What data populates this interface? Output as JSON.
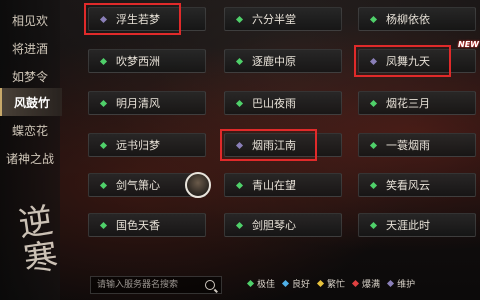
{
  "sidebar": {
    "items": [
      {
        "label": "相见欢"
      },
      {
        "label": "将进酒"
      },
      {
        "label": "如梦令"
      },
      {
        "label": "风鼓竹"
      },
      {
        "label": "蝶恋花"
      },
      {
        "label": "诸神之战"
      }
    ],
    "active_index": 3,
    "calligraphy": "逆寒"
  },
  "servers": [
    {
      "name": "浮生若梦",
      "status": "repair",
      "highlighted": true
    },
    {
      "name": "六分半堂",
      "status": "good",
      "highlighted": false
    },
    {
      "name": "杨柳依依",
      "status": "good",
      "highlighted": false
    },
    {
      "name": "吹梦西洲",
      "status": "good",
      "highlighted": false
    },
    {
      "name": "逐鹿中原",
      "status": "good",
      "highlighted": false
    },
    {
      "name": "凤舞九天",
      "status": "repair",
      "highlighted": true,
      "new": true
    },
    {
      "name": "明月清风",
      "status": "good",
      "highlighted": false
    },
    {
      "name": "巴山夜雨",
      "status": "good",
      "highlighted": false
    },
    {
      "name": "烟花三月",
      "status": "good",
      "highlighted": false
    },
    {
      "name": "远书归梦",
      "status": "good",
      "highlighted": false
    },
    {
      "name": "烟雨江南",
      "status": "repair",
      "highlighted": true
    },
    {
      "name": "一蓑烟雨",
      "status": "good",
      "highlighted": false
    },
    {
      "name": "剑气箫心",
      "status": "good",
      "highlighted": false,
      "avatar": true
    },
    {
      "name": "青山在望",
      "status": "good",
      "highlighted": false
    },
    {
      "name": "笑看风云",
      "status": "good",
      "highlighted": false
    },
    {
      "name": "国色天香",
      "status": "good",
      "highlighted": false
    },
    {
      "name": "剑胆琴心",
      "status": "good",
      "highlighted": false
    },
    {
      "name": "天涯此时",
      "status": "good",
      "highlighted": false
    }
  ],
  "new_badge": "NEW",
  "search": {
    "placeholder": "请输入服务器名搜索"
  },
  "legend": [
    {
      "label": "极佳",
      "color": "#4fd06a"
    },
    {
      "label": "良好",
      "color": "#4fb0e8"
    },
    {
      "label": "繁忙",
      "color": "#e8c23c"
    },
    {
      "label": "爆满",
      "color": "#e04040"
    },
    {
      "label": "维护",
      "color": "#8a7fb8"
    }
  ],
  "status_colors": {
    "good": "#4fd06a",
    "repair": "#8a7fb8"
  },
  "highlight_color": "#e02a2a"
}
